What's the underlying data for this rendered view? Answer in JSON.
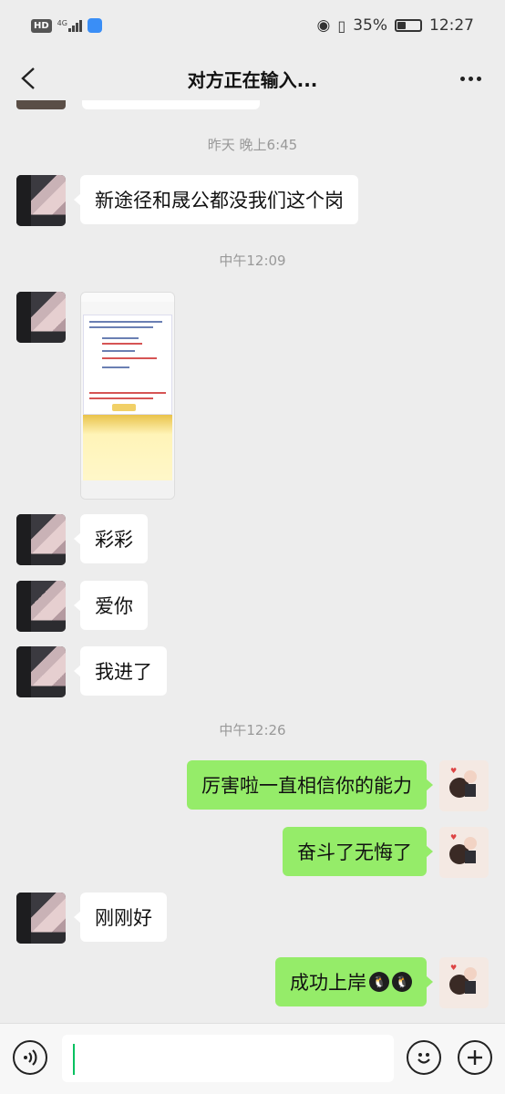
{
  "status_bar": {
    "hd": "HD",
    "network": "4G",
    "battery_percent": "35%",
    "battery_level": 0.35,
    "time": "12:27"
  },
  "header": {
    "title": "对方正在输入..."
  },
  "messages": [
    {
      "type": "time",
      "text": "昨天 晚上6:45"
    },
    {
      "type": "text",
      "side": "left",
      "text": "新途径和晟公都没我们这个岗"
    },
    {
      "type": "time",
      "text": "中午12:09"
    },
    {
      "type": "image",
      "side": "left"
    },
    {
      "type": "text",
      "side": "left",
      "text": "彩彩"
    },
    {
      "type": "text",
      "side": "left",
      "text": "爱你"
    },
    {
      "type": "text",
      "side": "left",
      "text": "我进了"
    },
    {
      "type": "time",
      "text": "中午12:26"
    },
    {
      "type": "text",
      "side": "right",
      "text": "厉害啦一直相信你的能力"
    },
    {
      "type": "text",
      "side": "right",
      "text": "奋斗了无悔了"
    },
    {
      "type": "text",
      "side": "left",
      "text": "刚刚好"
    },
    {
      "type": "text",
      "side": "right",
      "text": "成功上岸",
      "emojis": [
        "penguin-emoji",
        "penguin-emoji"
      ]
    }
  ],
  "input": {
    "value": ""
  },
  "icons": {
    "back": "back-arrow-icon",
    "more": "more-icon",
    "voice": "voice-icon",
    "emoji": "emoji-icon",
    "plus": "plus-icon"
  },
  "colors": {
    "background": "#ededed",
    "bubble_left": "#ffffff",
    "bubble_right": "#95ec69",
    "timestamp": "#999999",
    "caret": "#07c160"
  }
}
